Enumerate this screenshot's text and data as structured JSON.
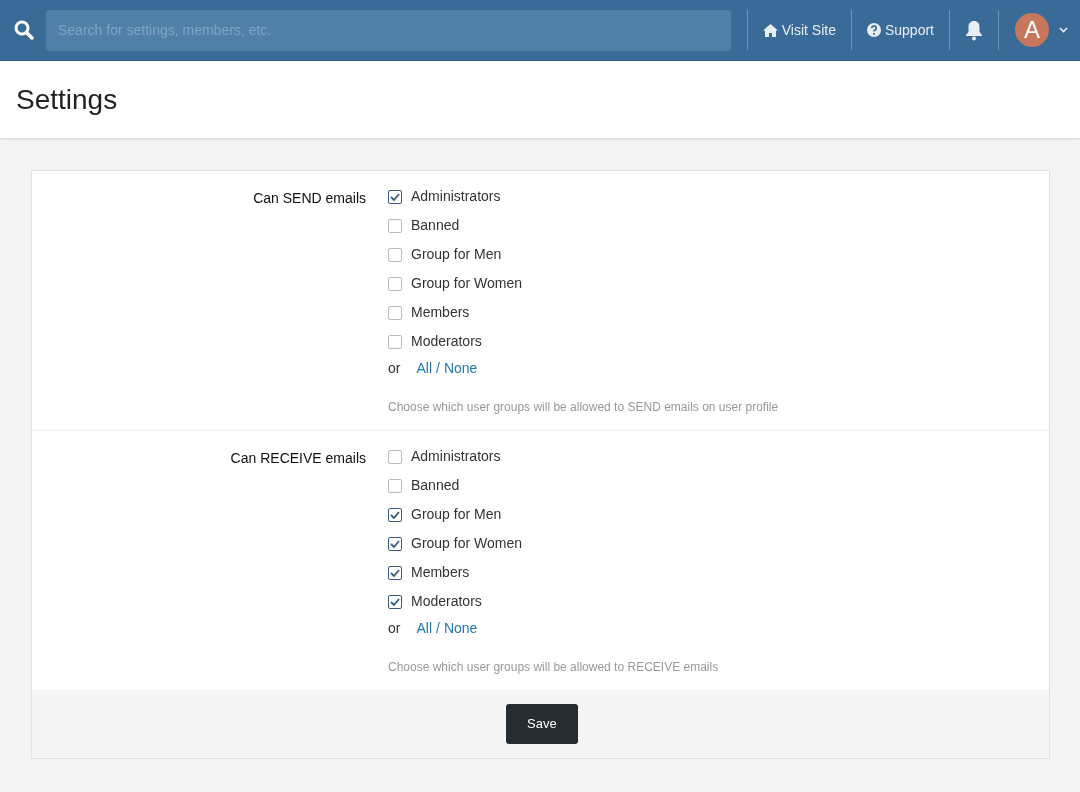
{
  "topbar": {
    "search": {
      "placeholder": "Search for settings, members, etc."
    },
    "links": [
      {
        "label": "Visit Site"
      },
      {
        "label": "Support"
      }
    ],
    "avatar": {
      "letter": "A"
    }
  },
  "page_title": "Settings",
  "settings": [
    {
      "label": "Can SEND emails",
      "groups": [
        {
          "name": "Administrators",
          "checked": true
        },
        {
          "name": "Banned",
          "checked": false
        },
        {
          "name": "Group for Men",
          "checked": false
        },
        {
          "name": "Group for Women",
          "checked": false
        },
        {
          "name": "Members",
          "checked": false
        },
        {
          "name": "Moderators",
          "checked": false
        }
      ],
      "or_text": "or",
      "all_link": "All",
      "separator": "/",
      "none_link": "None",
      "help": "Choose which user groups will be allowed to SEND emails on user profile"
    },
    {
      "label": "Can RECEIVE emails",
      "groups": [
        {
          "name": "Administrators",
          "checked": false
        },
        {
          "name": "Banned",
          "checked": false
        },
        {
          "name": "Group for Men",
          "checked": true
        },
        {
          "name": "Group for Women",
          "checked": true
        },
        {
          "name": "Members",
          "checked": true
        },
        {
          "name": "Moderators",
          "checked": true
        }
      ],
      "or_text": "or",
      "all_link": "All",
      "separator": "/",
      "none_link": "None",
      "help": "Choose which user groups will be allowed to RECEIVE emails"
    }
  ],
  "save_button": "Save"
}
